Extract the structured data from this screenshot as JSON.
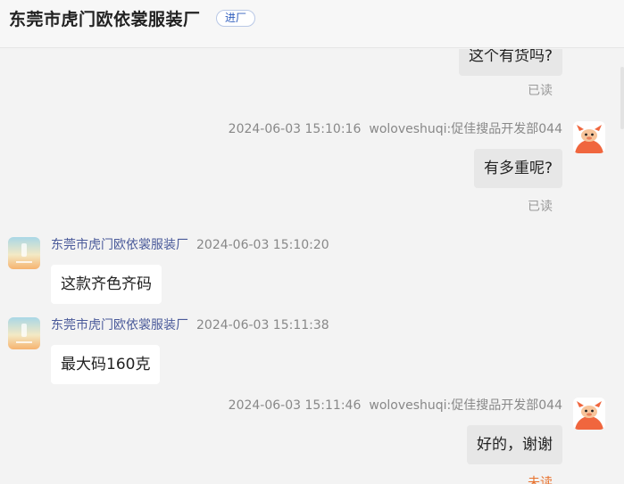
{
  "header": {
    "shop_name": "东莞市虎门欧依裳服装厂",
    "enter_label": "进厂"
  },
  "messages": [
    {
      "direction": "out",
      "text": "这个有货吗?",
      "status": "已读"
    },
    {
      "direction": "out",
      "time": "2024-06-03 15:10:16",
      "sender": "woloveshuqi:促佳搜品开发部044",
      "text": "有多重呢?",
      "status": "已读",
      "avatar": "mascot-avatar-icon"
    },
    {
      "direction": "in",
      "time": "2024-06-03 15:10:20",
      "sender": "东莞市虎门欧依裳服装厂",
      "text": "这款齐色齐码",
      "avatar": "shop-avatar-icon"
    },
    {
      "direction": "in",
      "time": "2024-06-03 15:11:38",
      "sender": "东莞市虎门欧依裳服装厂",
      "text": "最大码160克",
      "avatar": "shop-avatar-icon"
    },
    {
      "direction": "out",
      "time": "2024-06-03 15:11:46",
      "sender": "woloveshuqi:促佳搜品开发部044",
      "text": "好的，谢谢",
      "status": "未读",
      "avatar": "mascot-avatar-icon"
    }
  ],
  "colors": {
    "unread": "#e8712c",
    "read": "#9a9a9a",
    "mascot": "#f0663e"
  }
}
